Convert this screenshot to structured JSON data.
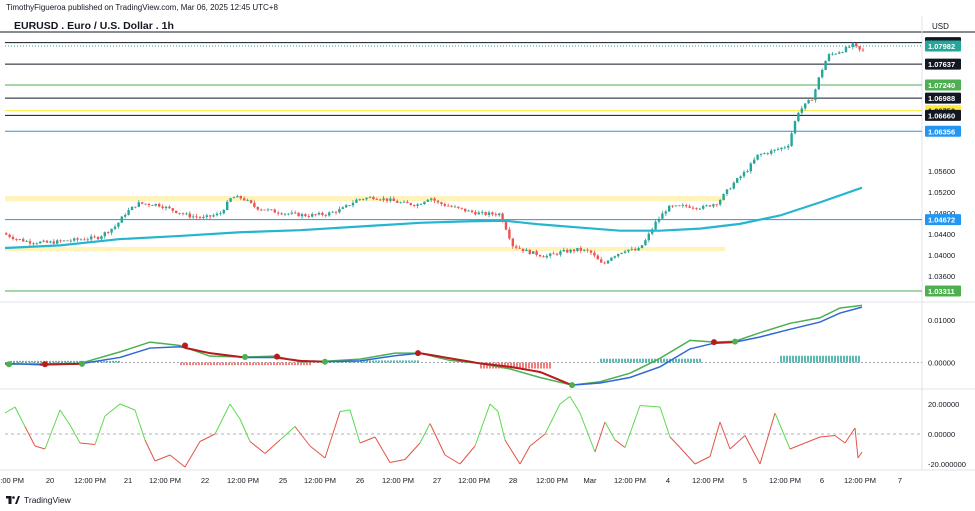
{
  "meta": {
    "published": "TimothyFigueroa published on TradingView.com, Mar 06, 2025 12:45 UTC+8",
    "brand": "TradingView",
    "currency": "USD"
  },
  "symbol": {
    "title": "EURUSD . Euro / U.S. Dollar . 1h"
  },
  "colors": {
    "up": "#26a69a",
    "down": "#ef5350",
    "ema": "#26b5cf",
    "zone": "#fff2b3",
    "blue_line": "#2196f3",
    "green_line": "#4caf50",
    "macd_blue": "#2f67d6",
    "macd_green": "#4caf50",
    "macd_dark_red": "#b71c1c",
    "osc_green": "#5bd94f",
    "osc_red": "#e55247"
  },
  "chart_data": [
    {
      "type": "candlestick",
      "title": "EURUSD . Euro / U.S. Dollar . 1h",
      "ylim": [
        1.031,
        1.0825
      ],
      "y_ticks": [
        "1.05600",
        "1.05200",
        "1.04800",
        "1.04400",
        "1.04000",
        "1.03600"
      ],
      "x_tick_labels": [
        "12:00 PM",
        "20",
        "12:00 PM",
        "21",
        "12:00 PM",
        "22",
        "12:00 PM",
        "25",
        "12:00 PM",
        "26",
        "12:00 PM",
        "27",
        "12:00 PM",
        "28",
        "12:00 PM",
        "Mar",
        "12:00 PM",
        "4",
        "12:00 PM",
        "5",
        "12:00 PM",
        "6",
        "12:00 PM",
        "7"
      ],
      "path_points": [
        [
          0,
          1.0445
        ],
        [
          18,
          1.0431
        ],
        [
          30,
          1.0425
        ],
        [
          50,
          1.0423
        ],
        [
          75,
          1.0428
        ],
        [
          100,
          1.0433
        ],
        [
          118,
          1.0455
        ],
        [
          128,
          1.048
        ],
        [
          140,
          1.0498
        ],
        [
          160,
          1.0496
        ],
        [
          175,
          1.0485
        ],
        [
          190,
          1.0475
        ],
        [
          205,
          1.047
        ],
        [
          222,
          1.0478
        ],
        [
          234,
          1.051
        ],
        [
          245,
          1.0508
        ],
        [
          258,
          1.049
        ],
        [
          275,
          1.0483
        ],
        [
          292,
          1.0478
        ],
        [
          310,
          1.0475
        ],
        [
          330,
          1.0478
        ],
        [
          345,
          1.0488
        ],
        [
          360,
          1.0506
        ],
        [
          376,
          1.051
        ],
        [
          390,
          1.0505
        ],
        [
          405,
          1.0498
        ],
        [
          420,
          1.0496
        ],
        [
          432,
          1.051
        ],
        [
          440,
          1.0499
        ],
        [
          455,
          1.0491
        ],
        [
          470,
          1.0483
        ],
        [
          485,
          1.0478
        ],
        [
          502,
          1.0478
        ],
        [
          508,
          1.0452
        ],
        [
          515,
          1.0418
        ],
        [
          530,
          1.0406
        ],
        [
          548,
          1.0397
        ],
        [
          563,
          1.0405
        ],
        [
          580,
          1.041
        ],
        [
          592,
          1.0406
        ],
        [
          600,
          1.039
        ],
        [
          605,
          1.038
        ],
        [
          612,
          1.0395
        ],
        [
          628,
          1.041
        ],
        [
          640,
          1.0408
        ],
        [
          648,
          1.0428
        ],
        [
          658,
          1.0462
        ],
        [
          670,
          1.049
        ],
        [
          690,
          1.0493
        ],
        [
          705,
          1.049
        ],
        [
          720,
          1.05
        ],
        [
          735,
          1.0535
        ],
        [
          750,
          1.0563
        ],
        [
          760,
          1.059
        ],
        [
          775,
          1.0598
        ],
        [
          790,
          1.0608
        ],
        [
          800,
          1.0672
        ],
        [
          815,
          1.07
        ],
        [
          822,
          1.0743
        ],
        [
          830,
          1.078
        ],
        [
          845,
          1.079
        ],
        [
          855,
          1.08
        ],
        [
          862,
          1.079
        ]
      ],
      "ema_points": [
        [
          5,
          1.0413
        ],
        [
          60,
          1.0418
        ],
        [
          120,
          1.043
        ],
        [
          180,
          1.0436
        ],
        [
          240,
          1.0443
        ],
        [
          300,
          1.0447
        ],
        [
          360,
          1.0454
        ],
        [
          420,
          1.0461
        ],
        [
          470,
          1.0464
        ],
        [
          505,
          1.0465
        ],
        [
          540,
          1.0458
        ],
        [
          580,
          1.0452
        ],
        [
          620,
          1.0446
        ],
        [
          660,
          1.0446
        ],
        [
          700,
          1.045
        ],
        [
          740,
          1.0459
        ],
        [
          780,
          1.0475
        ],
        [
          820,
          1.05
        ],
        [
          862,
          1.0528
        ]
      ],
      "horizontal_levels": [
        {
          "value": 1.08048,
          "label": "1.08048",
          "color": "#131722",
          "text_color": "#ffffff",
          "style": "solid"
        },
        {
          "value": 1.07982,
          "label": "1.07982",
          "color": "#26a69a",
          "text_color": "#ffffff",
          "style": "dotted"
        },
        {
          "value": 1.07637,
          "label": "1.07637",
          "color": "#131722",
          "text_color": "#ffffff",
          "style": "solid"
        },
        {
          "value": 1.0724,
          "label": "1.07240",
          "color": "#4caf50",
          "text_color": "#ffffff",
          "style": "solid"
        },
        {
          "value": 1.06988,
          "label": "1.06988",
          "color": "#131722",
          "text_color": "#ffffff",
          "style": "solid"
        },
        {
          "value": 1.0675,
          "label": "1.06750",
          "color": "#ffeb3b",
          "text_color": "#131722",
          "style": "solid"
        },
        {
          "value": 1.0666,
          "label": "1.06660",
          "color": "#131722",
          "text_color": "#ffffff",
          "style": "solid"
        },
        {
          "value": 1.06356,
          "label": "1.06356",
          "color": "#2196f3",
          "text_color": "#ffffff",
          "style": "solid"
        },
        {
          "value": 1.04672,
          "label": "1.04672",
          "color": "#2196f3",
          "text_color": "#ffffff",
          "style": "solid"
        },
        {
          "value": 1.03311,
          "label": "1.03311",
          "color": "#4caf50",
          "text_color": "#ffffff",
          "style": "solid"
        }
      ],
      "zones": [
        {
          "x0": 5,
          "x1": 725,
          "y_low": 1.0502,
          "y_high": 1.0512
        },
        {
          "x0": 5,
          "x1": 725,
          "y_low": 1.0407,
          "y_high": 1.0415
        }
      ],
      "ema_color": "#26b5cf"
    },
    {
      "type": "line",
      "ylim": [
        -0.0062,
        0.0142
      ],
      "y_ticks": [
        "0.01000",
        "0.00000"
      ],
      "series": [
        {
          "color": "#4caf50",
          "values": [
            [
              5,
              -0.0004
            ],
            [
              40,
              -0.0003
            ],
            [
              80,
              -0.0002
            ],
            [
              120,
              0.0025
            ],
            [
              150,
              0.0048
            ],
            [
              180,
              0.004
            ],
            [
              210,
              0.0015
            ],
            [
              245,
              0.0013
            ],
            [
              275,
              0.0015
            ],
            [
              300,
              0.0002
            ],
            [
              325,
              0.0003
            ],
            [
              360,
              0.0008
            ],
            [
              395,
              0.0022
            ],
            [
              420,
              0.0022
            ],
            [
              450,
              0.0005
            ],
            [
              480,
              -0.0002
            ],
            [
              510,
              -0.0015
            ],
            [
              540,
              -0.0035
            ],
            [
              572,
              -0.0053
            ],
            [
              600,
              -0.0045
            ],
            [
              630,
              -0.0025
            ],
            [
              660,
              0.001
            ],
            [
              690,
              0.0052
            ],
            [
              715,
              0.0048
            ],
            [
              735,
              0.005
            ],
            [
              760,
              0.007
            ],
            [
              790,
              0.0092
            ],
            [
              820,
              0.0105
            ],
            [
              840,
              0.0128
            ],
            [
              862,
              0.0134
            ]
          ]
        },
        {
          "color": "#2f67d6",
          "values": [
            [
              5,
              -0.0002
            ],
            [
              40,
              -0.0005
            ],
            [
              80,
              -0.0003
            ],
            [
              120,
              0.0012
            ],
            [
              150,
              0.0034
            ],
            [
              180,
              0.0037
            ],
            [
              210,
              0.0022
            ],
            [
              245,
              0.0012
            ],
            [
              275,
              0.0012
            ],
            [
              300,
              0.0004
            ],
            [
              325,
              0.0002
            ],
            [
              360,
              0.0004
            ],
            [
              395,
              0.0016
            ],
            [
              420,
              0.0022
            ],
            [
              450,
              0.001
            ],
            [
              480,
              -0.0002
            ],
            [
              510,
              -0.001
            ],
            [
              540,
              -0.0022
            ],
            [
              572,
              -0.0053
            ],
            [
              600,
              -0.0048
            ],
            [
              630,
              -0.0035
            ],
            [
              660,
              -0.001
            ],
            [
              690,
              0.0032
            ],
            [
              715,
              0.0046
            ],
            [
              735,
              0.0048
            ],
            [
              760,
              0.006
            ],
            [
              790,
              0.0078
            ],
            [
              820,
              0.0095
            ],
            [
              840,
              0.0116
            ],
            [
              862,
              0.013
            ]
          ]
        }
      ],
      "dots": [
        {
          "x": 9,
          "value": -0.0004,
          "color": "#4caf50"
        },
        {
          "x": 45,
          "value": -0.0004,
          "color": "#b71c1c"
        },
        {
          "x": 82,
          "value": -0.0003,
          "color": "#4caf50"
        },
        {
          "x": 185,
          "value": 0.004,
          "color": "#b71c1c"
        },
        {
          "x": 245,
          "value": 0.0013,
          "color": "#4caf50"
        },
        {
          "x": 277,
          "value": 0.0014,
          "color": "#b71c1c"
        },
        {
          "x": 325,
          "value": 0.0002,
          "color": "#4caf50"
        },
        {
          "x": 418,
          "value": 0.0022,
          "color": "#b71c1c"
        },
        {
          "x": 572,
          "value": -0.0053,
          "color": "#4caf50"
        },
        {
          "x": 714,
          "value": 0.0048,
          "color": "#b71c1c"
        },
        {
          "x": 735,
          "value": 0.0049,
          "color": "#4caf50"
        }
      ],
      "histogram": [
        {
          "x0": 10,
          "x1": 120,
          "value": 0.0004,
          "color": "#26a69a"
        },
        {
          "x0": 180,
          "x1": 310,
          "value": -0.0006,
          "color": "#ef5350"
        },
        {
          "x0": 330,
          "x1": 420,
          "value": 0.0005,
          "color": "#26a69a"
        },
        {
          "x0": 480,
          "x1": 552,
          "value": -0.0014,
          "color": "#ef5350"
        },
        {
          "x0": 600,
          "x1": 700,
          "value": 0.0009,
          "color": "#26a69a"
        },
        {
          "x0": 780,
          "x1": 860,
          "value": 0.0016,
          "color": "#26a69a"
        }
      ]
    },
    {
      "type": "line",
      "ylim": [
        -24,
        30
      ],
      "y_ticks": [
        "20.00000",
        "0.00000",
        "-20.000000"
      ],
      "values": [
        [
          5,
          14
        ],
        [
          15,
          18
        ],
        [
          25,
          5
        ],
        [
          35,
          -8
        ],
        [
          45,
          -10
        ],
        [
          60,
          16
        ],
        [
          70,
          6
        ],
        [
          80,
          -6
        ],
        [
          95,
          -7
        ],
        [
          105,
          12
        ],
        [
          120,
          20
        ],
        [
          135,
          16
        ],
        [
          145,
          -4
        ],
        [
          155,
          -18
        ],
        [
          170,
          -14
        ],
        [
          185,
          -22
        ],
        [
          200,
          -5
        ],
        [
          215,
          0
        ],
        [
          230,
          20
        ],
        [
          240,
          10
        ],
        [
          250,
          -5
        ],
        [
          265,
          -13
        ],
        [
          280,
          -4
        ],
        [
          295,
          5
        ],
        [
          310,
          -8
        ],
        [
          325,
          -16
        ],
        [
          340,
          15
        ],
        [
          350,
          16
        ],
        [
          360,
          -6
        ],
        [
          375,
          -2
        ],
        [
          390,
          -19
        ],
        [
          405,
          -17
        ],
        [
          420,
          -6
        ],
        [
          430,
          7
        ],
        [
          445,
          -14
        ],
        [
          460,
          -20
        ],
        [
          475,
          -8
        ],
        [
          490,
          20
        ],
        [
          498,
          15
        ],
        [
          505,
          -4
        ],
        [
          520,
          -20
        ],
        [
          530,
          -8
        ],
        [
          545,
          0
        ],
        [
          560,
          20
        ],
        [
          570,
          25
        ],
        [
          580,
          14
        ],
        [
          595,
          -12
        ],
        [
          605,
          8
        ],
        [
          615,
          -4
        ],
        [
          625,
          -9
        ],
        [
          640,
          19
        ],
        [
          660,
          18
        ],
        [
          670,
          -2
        ],
        [
          680,
          -9
        ],
        [
          695,
          -20
        ],
        [
          710,
          -15
        ],
        [
          720,
          8
        ],
        [
          730,
          -10
        ],
        [
          745,
          -1
        ],
        [
          760,
          -20
        ],
        [
          775,
          14
        ],
        [
          790,
          -10
        ],
        [
          805,
          -6
        ],
        [
          820,
          -2
        ],
        [
          835,
          -1
        ],
        [
          845,
          -6
        ],
        [
          855,
          4
        ],
        [
          858,
          -16
        ],
        [
          862,
          -12
        ]
      ],
      "neutral_value": 0
    }
  ]
}
